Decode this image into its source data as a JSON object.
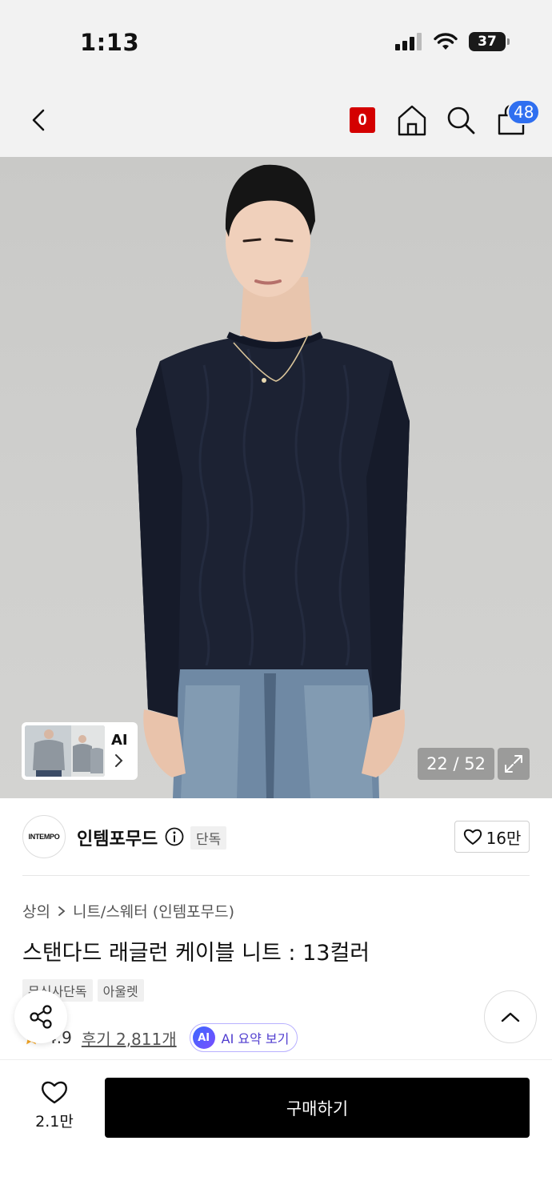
{
  "status_bar": {
    "time": "1:13",
    "battery": "37"
  },
  "nav": {
    "zero_badge": "0",
    "cart_count": "48"
  },
  "gallery": {
    "thumb_ai_label": "AI",
    "page_counter": "22 / 52"
  },
  "brand": {
    "logo_text": "INTEMPO",
    "name": "인템포무드",
    "tag": "단독",
    "follow_count": "16만"
  },
  "breadcrumb": {
    "category": "상의",
    "subcategory": "니트/스웨터 (인템포무드)"
  },
  "product": {
    "title": "스탠다드 래글런 케이블 니트 : 13컬러",
    "tags": [
      "무신사단독",
      "아울렛"
    ],
    "rating": "4.9",
    "reviews": "후기 2,811개",
    "ai_badge": "AI",
    "ai_summary": "AI 요약 보기"
  },
  "bottom": {
    "like_count": "2.1만",
    "buy_label": "구매하기"
  },
  "colors": {
    "accent_blue": "#2f6ff0",
    "badge_red": "#d40000",
    "sweater_navy": "#1c2233"
  }
}
